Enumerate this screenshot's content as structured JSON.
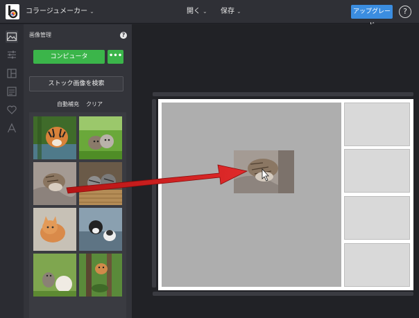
{
  "header": {
    "app_menu_label": "コラージュメーカー",
    "open_label": "開く",
    "save_label": "保存",
    "upgrade_label": "アップグレード",
    "help_label": "?"
  },
  "rail": {
    "items": [
      "image-icon",
      "sliders-icon",
      "layout-icon",
      "background-icon",
      "heart-icon",
      "text-icon"
    ]
  },
  "panel": {
    "title": "画像管理",
    "help_label": "?",
    "computer_button": "コンピュータ",
    "more_button": "•••",
    "stock_search_button": "ストック画像を検索",
    "autofill_link": "自動補充",
    "clear_link": "クリア",
    "thumbnails": [
      "tiger-photo",
      "kittens-grass-photo",
      "sleeping-cat-photo",
      "kittens-basket-photo",
      "orange-kitten-photo",
      "black-white-kittens-photo",
      "kitten-puppy-photo",
      "cat-tree-photo"
    ]
  },
  "colors": {
    "accent_green": "#3bb54a",
    "accent_blue": "#3b8de0",
    "arrow_red": "#d81e1e"
  }
}
